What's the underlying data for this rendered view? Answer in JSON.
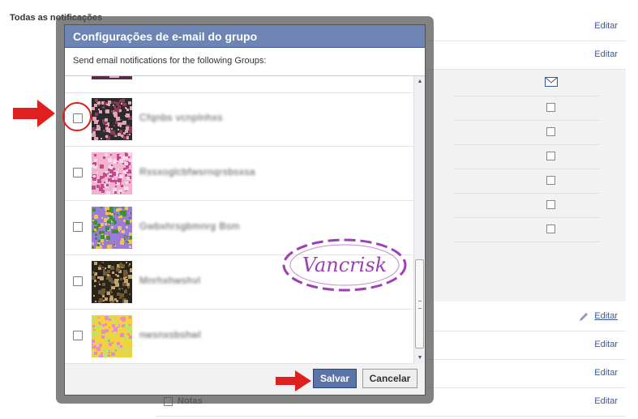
{
  "page": {
    "heading": "Todas as notificações",
    "edit_label": "Editar",
    "last_item_label": "Notas"
  },
  "dialog": {
    "title": "Configurações de e-mail do grupo",
    "subtitle": "Send email notifications for the following Groups:",
    "save_label": "Salvar",
    "cancel_label": "Cancelar",
    "groups": [
      {
        "name": "Cfqnbs vcnplnhxs",
        "checked": false,
        "colors": [
          "#2b2b2b",
          "#e1a3b8",
          "#8c3c5a"
        ]
      },
      {
        "name": "Rssxoglcbfwsrnqrsbsxsa",
        "checked": false,
        "colors": [
          "#f1b3d0",
          "#c44a8a",
          "#f7dbe8"
        ]
      },
      {
        "name": "Gwbxhrsgbmnrg Bsm",
        "checked": false,
        "colors": [
          "#9b7bd6",
          "#f0c25a",
          "#3c8d3c"
        ]
      },
      {
        "name": "Mnrhxhwshvl",
        "checked": false,
        "colors": [
          "#2a2418",
          "#c3a46b",
          "#6e5a3a"
        ]
      },
      {
        "name": "nwsnxsbshwl",
        "checked": false,
        "colors": [
          "#f4d23c",
          "#ee89c3",
          "#c2e06b"
        ]
      }
    ]
  },
  "watermark_text": "Vancrisk",
  "colors": {
    "title_bar": "#6d84b4",
    "primary_button": "#5b74a8",
    "annotation_red": "#d92121",
    "watermark_purple": "#9b3fb4",
    "link_blue": "#3b5998"
  },
  "icons": {
    "envelope": "envelope-icon",
    "pencil": "pencil-icon",
    "arrow": "red-arrow-icon"
  }
}
